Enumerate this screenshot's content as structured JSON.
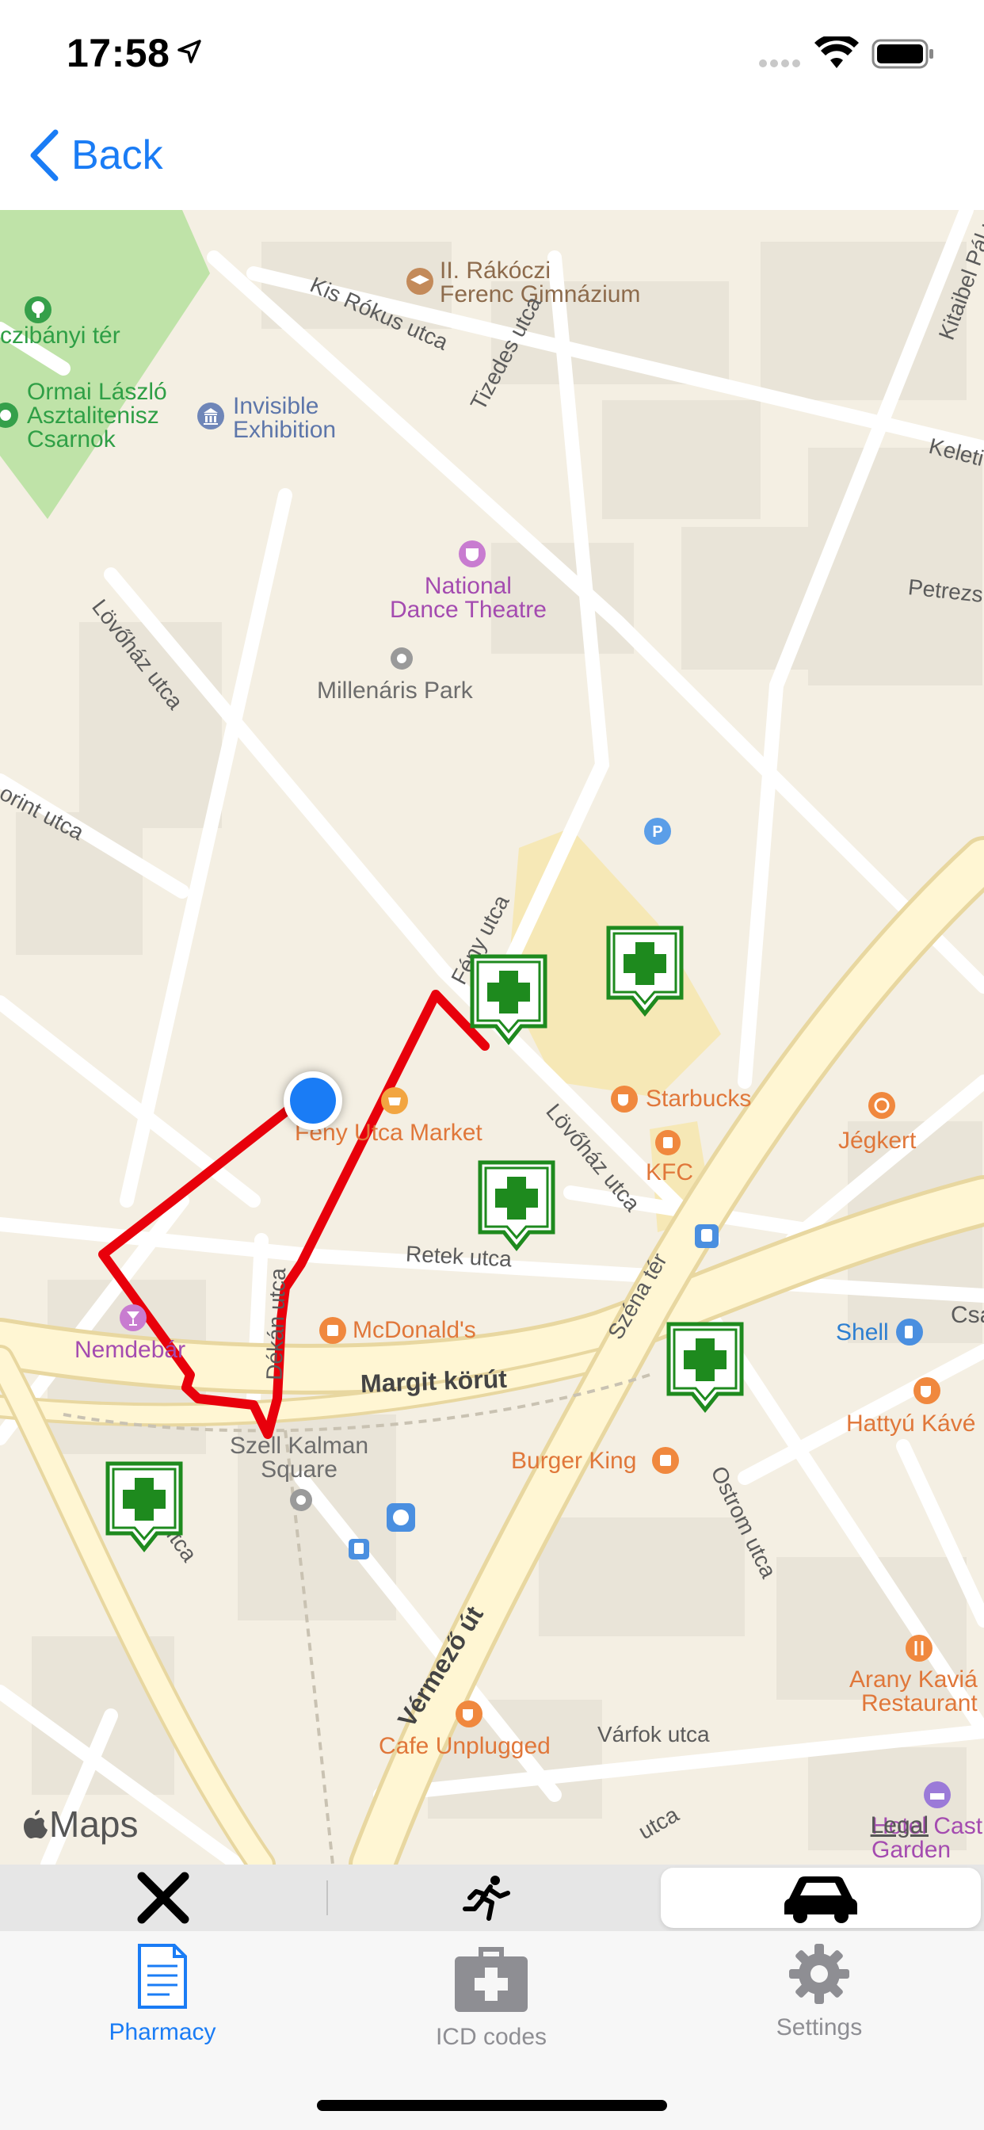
{
  "status_bar": {
    "time": "17:58"
  },
  "nav": {
    "back_label": "Back"
  },
  "map": {
    "labels": {
      "rakoczi": "II. Rákóczi\nFerenc Gimnázium",
      "invisible": "Invisible\nExhibition",
      "ormai": "Ormai László\nAsztalitenisz\nCsarnok",
      "czibanyi": "czibányi tér",
      "national_dance": "National\nDance Theatre",
      "millenaris": "Millenáris Park",
      "kis_rokus": "Kis Rókus utca",
      "tizedes": "Tizedes utca",
      "kitaibel": "Kitaibel Pál u",
      "keleti": "Keleti",
      "petrezs": "Petrezs",
      "lovohaz1": "Lövőház utca",
      "lovohaz2": "Lövőház utca",
      "torint": "orint utca",
      "feny": "Fény utca",
      "feny_market": "Fény Utca Market",
      "starbucks": "Starbucks",
      "kfc": "KFC",
      "jegkert": "Jégkert",
      "retek": "Retek utca",
      "dekan": "Dékán utca",
      "szena": "Széna tér",
      "nemdebar": "Nemdebár",
      "mcdonalds": "McDonald's",
      "margit": "Margit körút",
      "shell": "Shell",
      "csa": "Csa",
      "hattyu": "Hattyú Kávé",
      "szell": "Szell Kalman\nSquare",
      "burger_king": "Burger King",
      "ostrom": "Ostrom utca",
      "arany": "Arany Kaviá\nRestaurant",
      "vermezo": "Vérmező út",
      "cafe_unplugged": "Cafe Unplugged",
      "varfok": "Várfok utca",
      "hotel": "Hotel Cast\nGarden",
      "utca_ca": "utca",
      "utca_bottom": "utca",
      "parking": "P",
      "apple_maps": "Maps",
      "legal": "Legal"
    }
  },
  "segmented": {
    "options": [
      "close",
      "walking",
      "driving"
    ],
    "selected": "driving"
  },
  "tabs": [
    {
      "label": "Pharmacy",
      "active": true,
      "color": "#1a7cf5"
    },
    {
      "label": "ICD codes",
      "active": false,
      "color": "#8e8e93"
    },
    {
      "label": "Settings",
      "active": false,
      "color": "#8e8e93"
    }
  ],
  "colors": {
    "accent": "#1a7cf5",
    "route": "#e8000b",
    "pharmacy": "#1e8a1e",
    "map_bg": "#f4efe3",
    "road": "#fff6d3",
    "park": "#bfe3a8"
  }
}
